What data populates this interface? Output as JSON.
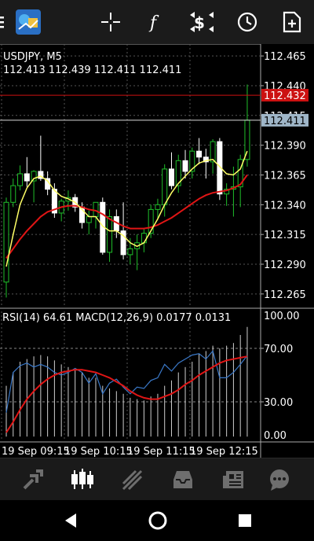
{
  "toolbar": {
    "icons": [
      "menu-icon",
      "app-logo",
      "crosshair-icon",
      "function-icon",
      "trade-icon",
      "clock-icon",
      "new-document-icon"
    ]
  },
  "chart_header": {
    "symbol": "USDJPY, M5",
    "ohlc": "112.413 112.439 112.411 112.411"
  },
  "price_axis": {
    "ticks": [
      "112.465",
      "112.440",
      "112.415",
      "112.390",
      "112.365",
      "112.340",
      "112.315",
      "112.290",
      "112.265"
    ],
    "ask_label": "112.432",
    "bid_label": "112.411"
  },
  "indicator": {
    "label": "RSI(14) 64.61 MACD(12,26,9) 0.0177 0.0131",
    "ticks": [
      "100.00",
      "70.00",
      "30.00",
      "0.00"
    ]
  },
  "time_axis": {
    "labels": [
      "19 Sep 09:15",
      "19 Sep 10:15",
      "19 Sep 11:15",
      "19 Sep 12:15"
    ]
  },
  "colors": {
    "bull": "#1fbf2a",
    "bear": "#ffffff",
    "fast_ma": "#ffff66",
    "slow_ma": "#e01515",
    "ask": "#cc1111",
    "bid_label_bg": "#9fb6c8",
    "rsi": "#3a78c8",
    "macd_signal": "#e01515"
  },
  "chart_data": {
    "type": "candlestick",
    "symbol": "USDJPY",
    "timeframe": "M5",
    "ylim": [
      112.253,
      112.475
    ],
    "ask": 112.432,
    "bid": 112.411,
    "x_labels": [
      "19 Sep 09:15",
      "19 Sep 10:15",
      "19 Sep 11:15",
      "19 Sep 12:15"
    ],
    "candles": [
      [
        112.275,
        112.346,
        112.262,
        112.342
      ],
      [
        112.342,
        112.362,
        112.338,
        112.356
      ],
      [
        112.356,
        112.373,
        112.352,
        112.366
      ],
      [
        112.366,
        112.38,
        112.355,
        112.36
      ],
      [
        112.36,
        112.369,
        112.342,
        112.368
      ],
      [
        112.368,
        112.398,
        112.36,
        112.362
      ],
      [
        112.362,
        112.368,
        112.348,
        112.353
      ],
      [
        112.353,
        112.358,
        112.329,
        112.333
      ],
      [
        112.333,
        112.345,
        112.326,
        112.343
      ],
      [
        112.343,
        112.352,
        112.335,
        112.346
      ],
      [
        112.346,
        112.349,
        112.334,
        112.338
      ],
      [
        112.338,
        112.342,
        112.32,
        112.325
      ],
      [
        112.325,
        112.335,
        112.315,
        112.33
      ],
      [
        112.33,
        112.342,
        112.32,
        112.342
      ],
      [
        112.342,
        112.346,
        112.298,
        112.3
      ],
      [
        112.3,
        112.336,
        112.292,
        112.33
      ],
      [
        112.33,
        112.336,
        112.312,
        112.318
      ],
      [
        112.318,
        112.342,
        112.294,
        112.298
      ],
      [
        112.298,
        112.312,
        112.29,
        112.303
      ],
      [
        112.303,
        112.315,
        112.285,
        112.308
      ],
      [
        112.308,
        112.32,
        112.3,
        112.316
      ],
      [
        112.316,
        112.34,
        112.312,
        112.336
      ],
      [
        112.336,
        112.345,
        112.328,
        112.34
      ],
      [
        112.34,
        112.374,
        112.33,
        112.37
      ],
      [
        112.37,
        112.384,
        112.353,
        112.356
      ],
      [
        112.356,
        112.382,
        112.35,
        112.377
      ],
      [
        112.377,
        112.386,
        112.362,
        112.368
      ],
      [
        112.368,
        112.388,
        112.362,
        112.385
      ],
      [
        112.385,
        112.396,
        112.374,
        112.38
      ],
      [
        112.38,
        112.387,
        112.362,
        112.376
      ],
      [
        112.376,
        112.395,
        112.366,
        112.393
      ],
      [
        112.393,
        112.396,
        112.344,
        112.349
      ],
      [
        112.349,
        112.358,
        112.339,
        112.353
      ],
      [
        112.353,
        112.372,
        112.33,
        112.355
      ],
      [
        112.355,
        112.382,
        112.338,
        112.378
      ],
      [
        112.378,
        112.441,
        112.372,
        112.411
      ]
    ],
    "fast_ma": [
      112.288,
      112.315,
      112.34,
      112.354,
      112.362,
      112.364,
      112.36,
      112.352,
      112.347,
      112.345,
      112.342,
      112.336,
      112.33,
      112.33,
      112.322,
      112.318,
      112.318,
      112.314,
      112.308,
      112.305,
      112.308,
      112.318,
      112.328,
      112.34,
      112.35,
      112.358,
      112.364,
      112.37,
      112.375,
      112.377,
      112.378,
      112.372,
      112.366,
      112.365,
      112.37,
      112.385
    ],
    "slow_ma": [
      112.295,
      112.303,
      112.311,
      112.318,
      112.324,
      112.33,
      112.334,
      112.336,
      112.338,
      112.339,
      112.339,
      112.338,
      112.336,
      112.335,
      112.332,
      112.328,
      112.325,
      112.322,
      112.32,
      112.32,
      112.32,
      112.321,
      112.323,
      112.326,
      112.329,
      112.333,
      112.337,
      112.341,
      112.345,
      112.348,
      112.35,
      112.351,
      112.352,
      112.354,
      112.357,
      112.365
    ],
    "rsi": [
      22,
      52,
      57,
      59,
      56,
      58,
      56,
      52,
      50,
      52,
      55,
      52,
      44,
      51,
      36,
      44,
      47,
      41,
      36,
      41,
      40,
      46,
      48,
      58,
      53,
      59,
      62,
      65,
      66,
      62,
      68,
      48,
      48,
      52,
      58,
      64.61
    ],
    "macd_hist": [
      42,
      52,
      60,
      62,
      64,
      65,
      64,
      61,
      58,
      56,
      54,
      52,
      48,
      48,
      42,
      40,
      38,
      36,
      33,
      32,
      31,
      34,
      36,
      42,
      46,
      52,
      56,
      60,
      66,
      68,
      72,
      70,
      72,
      74,
      80,
      86
    ],
    "macd_signal": [
      7,
      15,
      24,
      32,
      38,
      43,
      47,
      50,
      52,
      53,
      54,
      54,
      53,
      52,
      50,
      48,
      45,
      42,
      38,
      35,
      33,
      32,
      32,
      34,
      36,
      39,
      43,
      46,
      50,
      53,
      56,
      59,
      61,
      62,
      63,
      64
    ]
  },
  "tabbar": {
    "tabs": [
      "quotes-icon",
      "chart-icon",
      "trade-icon",
      "history-icon",
      "news-icon",
      "chat-icon"
    ],
    "active": "chart-icon"
  },
  "navbar": {
    "buttons": [
      "back-icon",
      "home-icon",
      "recents-icon"
    ]
  }
}
